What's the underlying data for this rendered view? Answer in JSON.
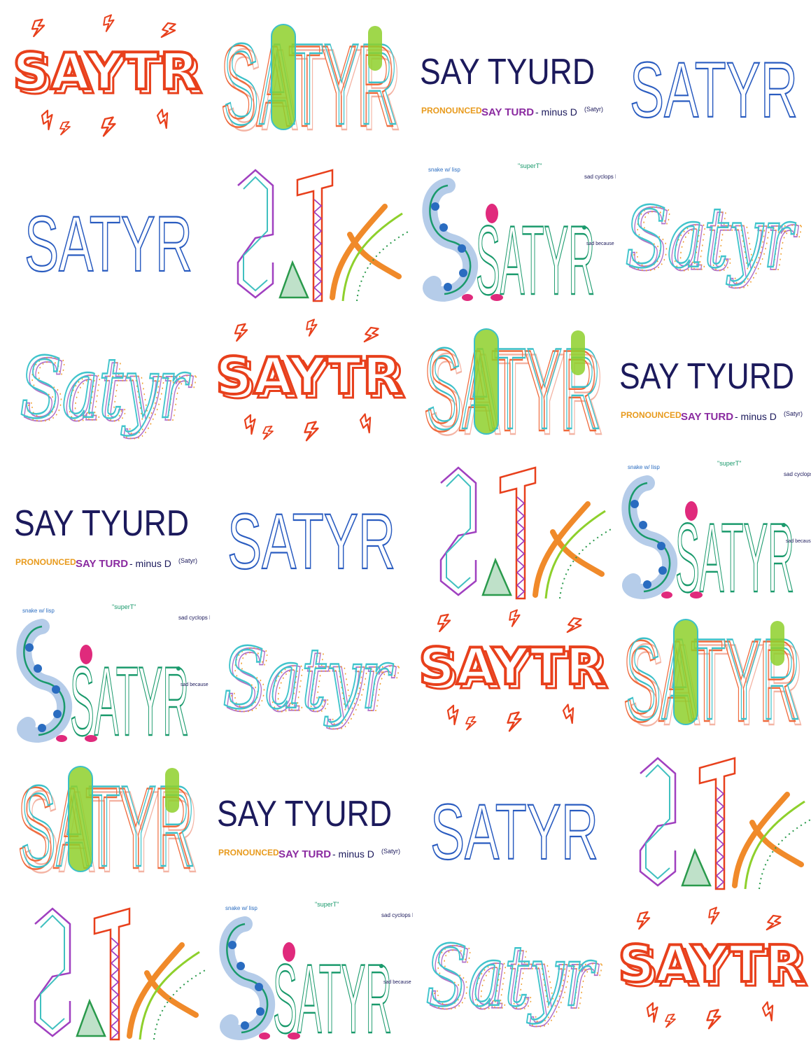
{
  "sheet": {
    "tiles": [
      {
        "style": "bolt",
        "text": "SAYTR"
      },
      {
        "style": "stripe",
        "text": "SATYR"
      },
      {
        "style": "sayturd",
        "text": "SAY TYURD",
        "sub1": "PRONOUNCED",
        "sub2": "SAY TURD",
        "sub3": "- minus D",
        "sub4": "(Satyr)"
      },
      {
        "style": "plain",
        "text": "SATYR"
      },
      {
        "style": "plain",
        "text": "SATYR"
      },
      {
        "style": "geo",
        "text": "SATYR"
      },
      {
        "style": "monster",
        "text": "SATYR",
        "notes": [
          "snake w/ lisp",
          "\"superT\"",
          "sad cyclops R",
          "sad because his wife left him"
        ]
      },
      {
        "style": "script",
        "text": "Satyr"
      },
      {
        "style": "script",
        "text": "Satyr"
      },
      {
        "style": "bolt",
        "text": "SAYTR"
      },
      {
        "style": "stripe",
        "text": "SATYR"
      },
      {
        "style": "sayturd",
        "text": "SAY TYURD",
        "sub1": "PRONOUNCED",
        "sub2": "SAY TURD",
        "sub3": "- minus D",
        "sub4": "(Satyr)"
      },
      {
        "style": "sayturd",
        "text": "SAY TYURD",
        "sub1": "PRONOUNCED",
        "sub2": "SAY TURD",
        "sub3": "- minus D",
        "sub4": "(Satyr)"
      },
      {
        "style": "plain",
        "text": "SATYR"
      },
      {
        "style": "geo",
        "text": "SATYR"
      },
      {
        "style": "monster",
        "text": "SATYR",
        "notes": [
          "snake w/ lisp",
          "\"superT\"",
          "sad cyclops R",
          "sad because his wife left him"
        ]
      },
      {
        "style": "monster",
        "text": "SATYR",
        "notes": [
          "snake w/ lisp",
          "\"superT\"",
          "sad cyclops R",
          "sad because his wife left him"
        ]
      },
      {
        "style": "script",
        "text": "Satyr"
      },
      {
        "style": "bolt",
        "text": "SAYTR"
      },
      {
        "style": "stripe",
        "text": "SATYR"
      },
      {
        "style": "stripe",
        "text": "SATYR"
      },
      {
        "style": "sayturd",
        "text": "SAY TYURD",
        "sub1": "PRONOUNCED",
        "sub2": "SAY TURD",
        "sub3": "- minus D",
        "sub4": "(Satyr)"
      },
      {
        "style": "plain",
        "text": "SATYR"
      },
      {
        "style": "geo",
        "text": "SATYR"
      },
      {
        "style": "geo",
        "text": "SATYR"
      },
      {
        "style": "monster",
        "text": "SATYR",
        "notes": [
          "snake w/ lisp",
          "\"superT\"",
          "sad cyclops R",
          "sad because his wife left him"
        ]
      },
      {
        "style": "script",
        "text": "Satyr"
      },
      {
        "style": "bolt",
        "text": "SAYTR"
      }
    ]
  },
  "colors": {
    "bolt": "#e8401c",
    "stripe_orange": "#ef6a3c",
    "stripe_pink": "#f4b4a4",
    "stripe_teal": "#3cc0c8",
    "stripe_green": "#8ed02c",
    "sayturd_navy": "#1c1a5c",
    "sayturd_pink": "#d8409c",
    "sayturd_orange": "#e89a1c",
    "sayturd_purple": "#8a2aa0",
    "plain_blue": "#2a5cc0",
    "geo_purple": "#a040c0",
    "geo_teal": "#40c0c0",
    "geo_green": "#2a9a4c",
    "geo_orange": "#f08a2a",
    "monster_green": "#1a9a6c",
    "monster_blue": "#2a6cc0",
    "monster_pink": "#e02a7c",
    "script_teal": "#40c4cc",
    "script_orange": "#f0a030",
    "script_purple": "#b070c8"
  }
}
